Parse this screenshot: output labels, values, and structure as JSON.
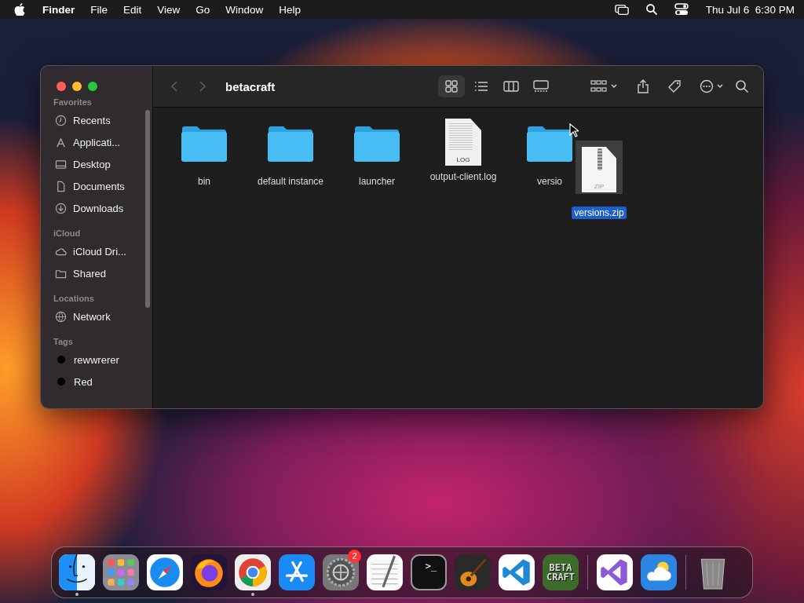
{
  "menu_bar": {
    "app_name": "Finder",
    "menus": [
      "File",
      "Edit",
      "View",
      "Go",
      "Window",
      "Help"
    ],
    "clock": "Thu Jul 6  6:30 PM"
  },
  "window": {
    "title": "betacraft",
    "toolbar": {
      "back_disabled": true,
      "forward_disabled": true,
      "views": [
        {
          "kind": "icons",
          "selected": true
        },
        {
          "kind": "list",
          "selected": false
        },
        {
          "kind": "columns",
          "selected": false
        },
        {
          "kind": "gallery",
          "selected": false
        }
      ]
    },
    "sidebar": [
      {
        "heading": "Favorites",
        "items": [
          {
            "kind": "clock",
            "label": "Recents"
          },
          {
            "kind": "apps",
            "label": "Applicati..."
          },
          {
            "kind": "desktop",
            "label": "Desktop"
          },
          {
            "kind": "document",
            "label": "Documents"
          },
          {
            "kind": "download",
            "label": "Downloads"
          }
        ]
      },
      {
        "heading": "iCloud",
        "items": [
          {
            "kind": "cloud",
            "label": "iCloud Dri..."
          },
          {
            "kind": "shared",
            "label": "Shared"
          }
        ]
      },
      {
        "heading": "Locations",
        "items": [
          {
            "kind": "globe",
            "label": "Network"
          }
        ]
      },
      {
        "heading": "Tags",
        "items": [
          {
            "kind": "tag",
            "label": "rewwrerer",
            "color": "#000000"
          },
          {
            "kind": "tag",
            "label": "Red",
            "color": "#000000"
          }
        ]
      }
    ],
    "files": [
      {
        "kind": "folder",
        "name": "bin"
      },
      {
        "kind": "folder",
        "name": "default instance"
      },
      {
        "kind": "folder",
        "name": "launcher"
      },
      {
        "kind": "log",
        "name": "output-client.log",
        "badge": "LOG"
      },
      {
        "kind": "folder",
        "name": "versio"
      }
    ],
    "dragged": {
      "name": "versions.zip",
      "badge": "ZIP",
      "selected": true
    }
  },
  "dock": [
    {
      "kind": "finder",
      "running": true
    },
    {
      "kind": "launchpad",
      "running": false
    },
    {
      "kind": "safari",
      "running": false
    },
    {
      "kind": "firefox",
      "running": false
    },
    {
      "kind": "chrome",
      "running": true
    },
    {
      "kind": "appstore",
      "running": false
    },
    {
      "kind": "settings",
      "running": false,
      "badge": "2"
    },
    {
      "kind": "textedit",
      "running": false
    },
    {
      "kind": "terminal",
      "running": false,
      "text": ">_"
    },
    {
      "kind": "guitar",
      "running": false
    },
    {
      "kind": "vscode",
      "running": false
    },
    {
      "kind": "betacraft",
      "running": false,
      "text": "BETA CRAFT"
    },
    {
      "kind": "separator"
    },
    {
      "kind": "visualstudio",
      "running": false
    },
    {
      "kind": "weather",
      "running": false
    },
    {
      "kind": "separator"
    },
    {
      "kind": "trash",
      "running": false
    }
  ]
}
